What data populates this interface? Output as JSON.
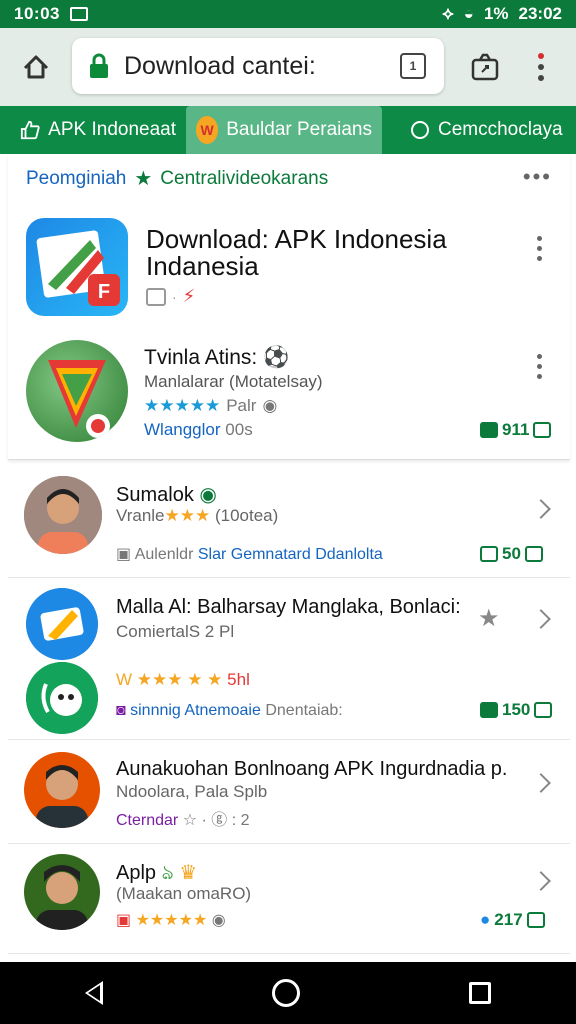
{
  "status_bar": {
    "time_left": "10:03",
    "battery_pct": "1%",
    "clock": "23:02"
  },
  "url_bar": {
    "url_text": "Download cantei:",
    "tabs_count": "1"
  },
  "tabs": [
    {
      "label": "APK Indoneaat"
    },
    {
      "label": "Bauldar Peraians",
      "logo": "W"
    },
    {
      "label": "Cemcchoclaya"
    }
  ],
  "section": {
    "title_blue": "Peomginiah",
    "title_green": "Centralivideokarans"
  },
  "featured": {
    "title": "Download: APK Indonesia Indanesia"
  },
  "app2": {
    "title": "Tvinla Atins:",
    "subtitle": "Manlalarar (Motatelsay)",
    "stars": "★★★★★",
    "rating_text": "Palr",
    "meta_blue": "Wlangglor",
    "meta_grey": "00s",
    "count": "911"
  },
  "rows": [
    {
      "title": "Sumalok",
      "sub_prefix": "Vranle",
      "stars": "★★★",
      "sub_suffix": "(10otea)",
      "meta_grey": "Aulenldr",
      "meta_blue": "Slar Gemnatard Ddanlolta",
      "count": "50"
    },
    {
      "title": "Malla Al: Balharsay Manglaka, Bonlaci:",
      "sub": "ComiertalS 2 Pl"
    },
    {
      "stars_text": "W ★★★ ★ ★",
      "extra": "5hl",
      "meta_blue": "sinnnig Atnemoaie",
      "meta_grey": "Dnentaiab:",
      "count": "150"
    },
    {
      "title": "Aunakuohan Bonlnoang APK Ingurdnadia p.",
      "sub": "Ndoolara, Pala Splb",
      "meta_blue": "Cterndar",
      "meta_grey": "☆ · ⓖ : 2"
    },
    {
      "title": "Aplp",
      "sub": "(Maakan omaRO)",
      "stars": "★★★★★",
      "count": "217"
    }
  ],
  "colors": {
    "brand_green": "#0b7a3b",
    "tab_highlight": "#59b687",
    "link_blue": "#1565c0"
  }
}
